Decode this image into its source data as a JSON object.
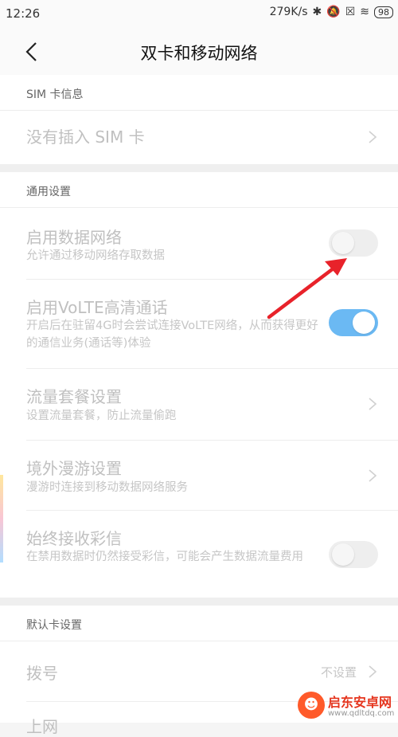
{
  "status": {
    "time": "12:26",
    "speed": "279K/s",
    "battery": "98"
  },
  "header": {
    "title": "双卡和移动网络"
  },
  "sim_section": {
    "label": "SIM 卡信息",
    "no_sim": "没有插入 SIM 卡"
  },
  "general": {
    "label": "通用设置",
    "items": [
      {
        "title": "启用数据网络",
        "sub": "允许通过移动网络存取数据",
        "toggle": false
      },
      {
        "title": "启用VoLTE高清通话",
        "sub": "开启后在驻留4G时会尝试连接VoLTE网络，从而获得更好的通信业务(通话等)体验",
        "toggle": true
      },
      {
        "title": "流量套餐设置",
        "sub": "设置流量套餐，防止流量偷跑"
      },
      {
        "title": "境外漫游设置",
        "sub": "漫游时连接到移动数据网络服务"
      },
      {
        "title": "始终接收彩信",
        "sub": "在禁用数据时仍然接受彩信，可能会产生数据流量费用",
        "toggle": false
      }
    ]
  },
  "default_card": {
    "label": "默认卡设置",
    "dial": "拨号",
    "dial_value": "不设置",
    "internet": "上网"
  },
  "watermark": {
    "title": "启东安卓网",
    "url": "www.qdltdq.com"
  },
  "colors": {
    "toggle_on": "#3aa2f0",
    "arrow": "#e8222a"
  }
}
